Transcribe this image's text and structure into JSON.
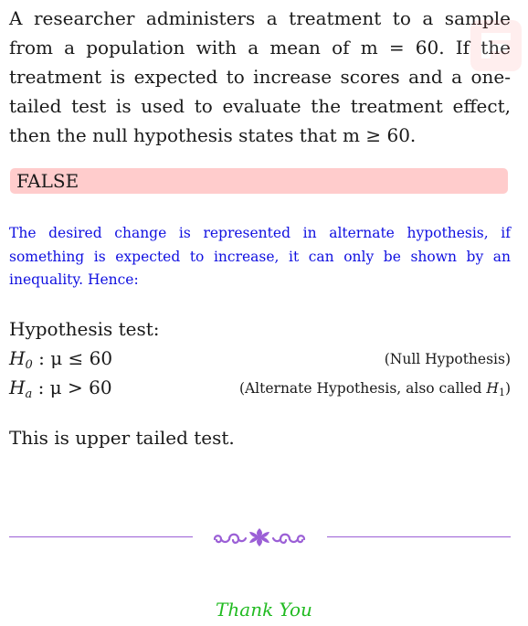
{
  "question": {
    "text": "A researcher administers a treatment to a sample from a population with a mean of m = 60. If the treatment is expected to increase scores and a one-tailed test is used to evaluate the treatment effect, then the null hypothesis states that m ≥ 60."
  },
  "answer": {
    "label": "FALSE",
    "background": "#ffcccc"
  },
  "explanation": {
    "text": "The desired change is represented in alternate hypothesis, if something is expected to increase, it can only be shown by an inequality. Hence:",
    "color": "#1010e0"
  },
  "hypothesis": {
    "title": "Hypothesis test:",
    "null": {
      "symbol": "H",
      "subscript": "0",
      "expression": " : μ ≤ 60",
      "note": "(Null Hypothesis)"
    },
    "alternate": {
      "symbol": "H",
      "subscript": "a",
      "expression": " : μ > 60",
      "note_prefix": "(Alternate Hypothesis, also called ",
      "note_symbol": "H",
      "note_subscript": "1",
      "note_suffix": ")"
    }
  },
  "conclusion": "This is upper tailed test.",
  "divider": {
    "ornament_icon": "scroll-ornament-icon",
    "color": "#9b5fd6"
  },
  "watermark_icon": "logo-watermark-icon",
  "thanks": {
    "text": "Thank You",
    "color": "#22bb22"
  }
}
